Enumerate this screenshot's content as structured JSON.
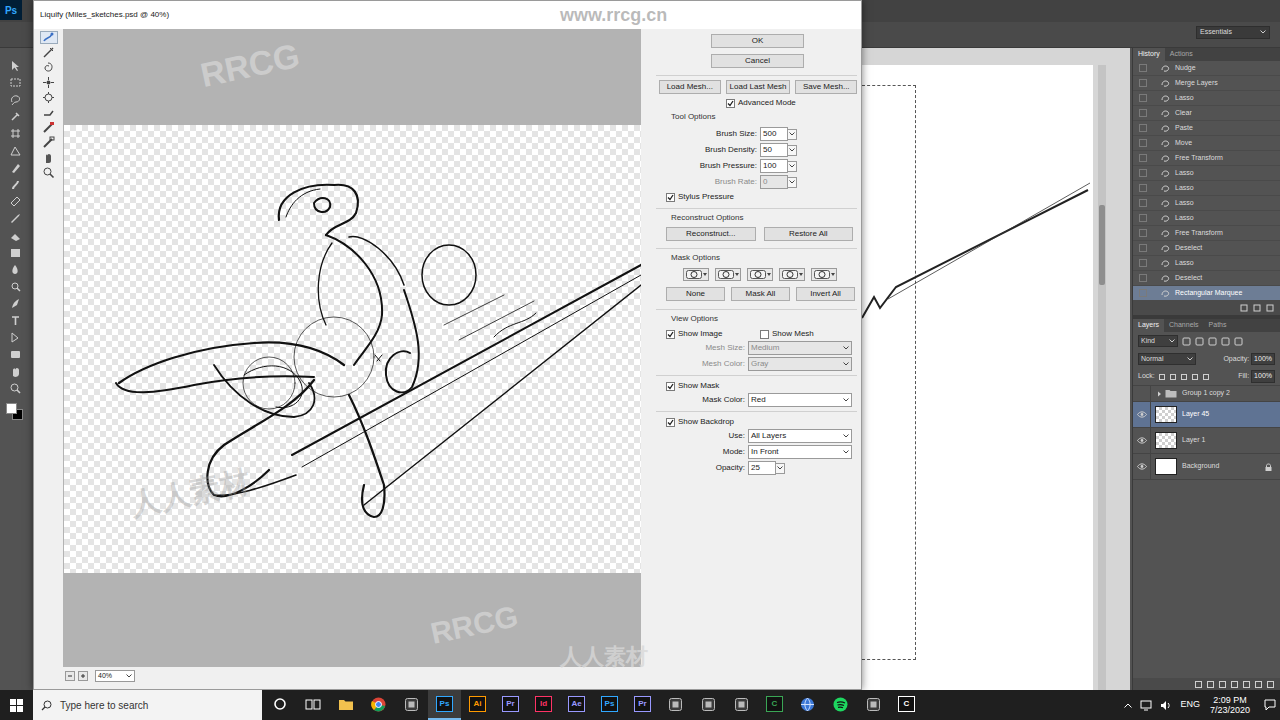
{
  "app": {
    "logo": "Ps",
    "workspace": "Essentials"
  },
  "watermarks": [
    "www.rrcg.cn",
    "RRCG",
    "人人素材",
    "RRCG",
    "人人素材"
  ],
  "liquify": {
    "title": "Liquify (Miles_sketches.psd @ 40%)",
    "zoom": "40%",
    "ok": "OK",
    "cancel": "Cancel",
    "mesh_buttons": [
      "Load Mesh...",
      "Load Last Mesh",
      "Save Mesh..."
    ],
    "advanced_mode": {
      "label": "Advanced Mode",
      "checked": true
    },
    "tool_options": {
      "heading": "Tool Options",
      "fields": [
        {
          "label": "Brush Size:",
          "value": "500",
          "disabled": false
        },
        {
          "label": "Brush Density:",
          "value": "50",
          "disabled": false
        },
        {
          "label": "Brush Pressure:",
          "value": "100",
          "disabled": false
        },
        {
          "label": "Brush Rate:",
          "value": "0",
          "disabled": true
        }
      ],
      "stylus_pressure": {
        "label": "Stylus Pressure",
        "checked": true
      }
    },
    "reconstruct": {
      "heading": "Reconstruct Options",
      "buttons": [
        "Reconstruct...",
        "Restore All"
      ]
    },
    "mask": {
      "heading": "Mask Options",
      "buttons": [
        "None",
        "Mask All",
        "Invert All"
      ]
    },
    "view": {
      "heading": "View Options",
      "show_image": {
        "label": "Show Image",
        "checked": true
      },
      "show_mesh": {
        "label": "Show Mesh",
        "checked": false
      },
      "mesh_size": {
        "label": "Mesh Size:",
        "value": "Medium",
        "disabled": true
      },
      "mesh_color": {
        "label": "Mesh Color:",
        "value": "Gray",
        "disabled": true
      },
      "show_mask": {
        "label": "Show Mask",
        "checked": true
      },
      "mask_color": {
        "label": "Mask Color:",
        "value": "Red",
        "disabled": false
      },
      "show_backdrop": {
        "label": "Show Backdrop",
        "checked": true
      },
      "use": {
        "label": "Use:",
        "value": "All Layers",
        "disabled": false
      },
      "mode": {
        "label": "Mode:",
        "value": "In Front",
        "disabled": false
      },
      "opacity": {
        "label": "Opacity:",
        "value": "25",
        "disabled": false
      }
    }
  },
  "history": {
    "tabs": [
      {
        "label": "History",
        "selected": true
      },
      {
        "label": "Actions",
        "selected": false
      }
    ],
    "items": [
      {
        "label": "Nudge",
        "selected": false
      },
      {
        "label": "Merge Layers",
        "selected": false
      },
      {
        "label": "Lasso",
        "selected": false
      },
      {
        "label": "Clear",
        "selected": false
      },
      {
        "label": "Paste",
        "selected": false
      },
      {
        "label": "Move",
        "selected": false
      },
      {
        "label": "Free Transform",
        "selected": false
      },
      {
        "label": "Lasso",
        "selected": false
      },
      {
        "label": "Lasso",
        "selected": false
      },
      {
        "label": "Lasso",
        "selected": false
      },
      {
        "label": "Lasso",
        "selected": false
      },
      {
        "label": "Free Transform",
        "selected": false
      },
      {
        "label": "Deselect",
        "selected": false
      },
      {
        "label": "Lasso",
        "selected": false
      },
      {
        "label": "Deselect",
        "selected": false
      },
      {
        "label": "Rectangular Marquee",
        "selected": true
      }
    ]
  },
  "layers": {
    "tabs": [
      {
        "label": "Layers",
        "selected": true
      },
      {
        "label": "Channels",
        "selected": false
      },
      {
        "label": "Paths",
        "selected": false
      }
    ],
    "filter": "Kind",
    "blend": "Normal",
    "opacity_label": "Opacity:",
    "opacity": "100%",
    "lock_label": "Lock:",
    "fill_label": "Fill:",
    "fill": "100%",
    "items": [
      {
        "name": "Group 1 copy 2",
        "kind": "group",
        "selected": false,
        "visible": false,
        "locked": false
      },
      {
        "name": "Layer 45",
        "kind": "layer",
        "selected": true,
        "visible": true,
        "locked": false
      },
      {
        "name": "Layer 1",
        "kind": "layer",
        "selected": false,
        "visible": true,
        "locked": false
      },
      {
        "name": "Background",
        "kind": "background",
        "selected": false,
        "visible": true,
        "locked": true
      }
    ]
  },
  "taskbar": {
    "search": "Type here to search",
    "apps": [
      {
        "kind": "cortana",
        "active": false
      },
      {
        "kind": "taskview",
        "active": false
      },
      {
        "kind": "folder",
        "active": false
      },
      {
        "kind": "chrome",
        "active": false
      },
      {
        "kind": "generic",
        "active": false
      },
      {
        "kind": "badge",
        "label": "Ps",
        "color": "#31a8ff",
        "active": true
      },
      {
        "kind": "badge",
        "label": "Ai",
        "color": "#ff9a00",
        "active": false
      },
      {
        "kind": "badge",
        "label": "Pr",
        "color": "#9999ff",
        "active": false
      },
      {
        "kind": "badge",
        "label": "Id",
        "color": "#ff3366",
        "active": false
      },
      {
        "kind": "badge",
        "label": "Ae",
        "color": "#9999ff",
        "active": false
      },
      {
        "kind": "badge",
        "label": "Ps",
        "color": "#31a8ff",
        "active": false
      },
      {
        "kind": "badge",
        "label": "Pr",
        "color": "#9999ff",
        "active": false
      },
      {
        "kind": "generic",
        "active": false
      },
      {
        "kind": "generic",
        "active": false
      },
      {
        "kind": "generic",
        "active": false
      },
      {
        "kind": "badge",
        "label": "C",
        "color": "#3aa655",
        "active": false
      },
      {
        "kind": "globe",
        "active": false
      },
      {
        "kind": "spotify",
        "active": false
      },
      {
        "kind": "generic",
        "active": false
      },
      {
        "kind": "badge",
        "label": "C",
        "color": "#ffffff",
        "active": false
      }
    ],
    "lang": "ENG",
    "time": "2:09 PM",
    "date": "7/23/2020"
  }
}
